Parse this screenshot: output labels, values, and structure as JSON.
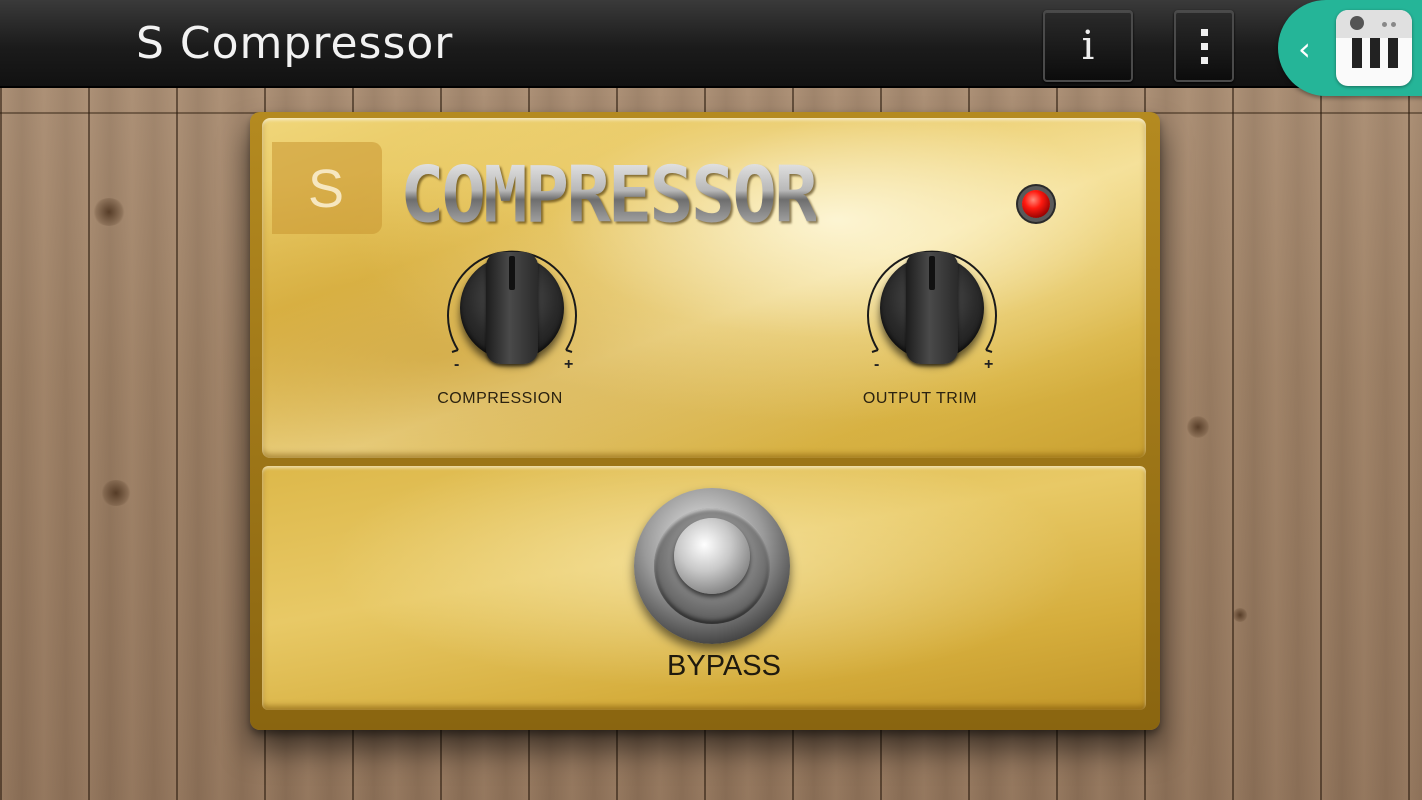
{
  "app": {
    "title": "S Compressor",
    "info_label": "i"
  },
  "side_panel": {
    "back_icon": "chevron-left-icon",
    "launcher_icon": "piano-app-icon",
    "color": "#25b598"
  },
  "pedal": {
    "badge": "S",
    "title": "COMPRESSOR",
    "led": {
      "state": "on",
      "color": "#ff1a10"
    },
    "knobs": [
      {
        "label": "COMPRESSION",
        "minus": "-",
        "plus": "+",
        "level": 0.5
      },
      {
        "label": "OUTPUT TRIM",
        "minus": "-",
        "plus": "+",
        "level": 0.5
      }
    ],
    "footswitch_label": "BYPASS",
    "finish_color": "#e3bf52"
  },
  "background": {
    "style": "wood planks",
    "color": "#9c7f64"
  }
}
